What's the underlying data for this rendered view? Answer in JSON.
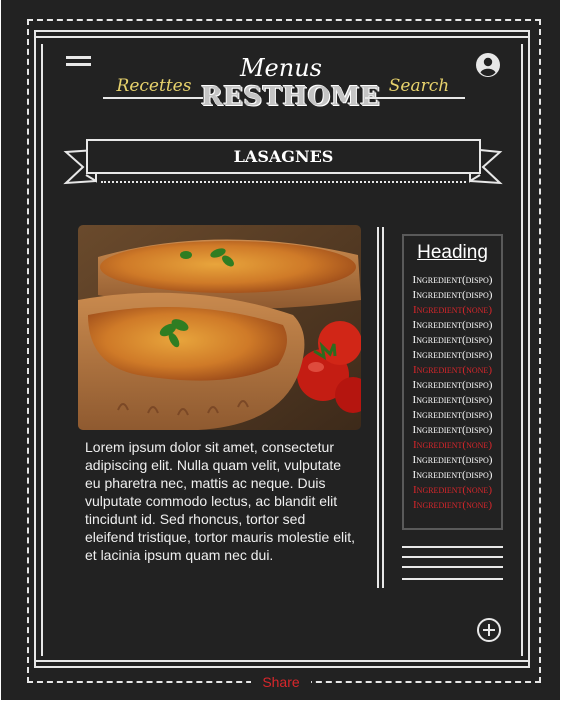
{
  "header": {
    "menus_label": "Menus",
    "brand": "RESTHOME",
    "nav_left": "Recettes",
    "nav_right": "Search"
  },
  "icons": {
    "menu": "hamburger-icon",
    "account": "account-circle-icon",
    "add": "add-circle-icon"
  },
  "banner": {
    "title": "LASAGNES"
  },
  "recipe": {
    "image_alt": "Two dishes of baked lasagne with basil and tomatoes",
    "description": "Lorem ipsum dolor sit amet, consectetur adipiscing elit. Nulla quam velit, vulputate eu pharetra nec, mattis ac neque. Duis vulputate commodo lectus, ac blandit elit tincidunt id. Sed rhoncus, tortor sed eleifend tristique, tortor mauris molestie elit, et lacinia ipsum quam nec dui."
  },
  "ingredients": {
    "heading": "Heading",
    "items": [
      {
        "label": "Ingredient(dispo)",
        "available": true
      },
      {
        "label": "Ingredient(dispo)",
        "available": true
      },
      {
        "label": "Ingredient(none)",
        "available": false
      },
      {
        "label": "Ingredient(dispo)",
        "available": true
      },
      {
        "label": "Ingredient(dispo)",
        "available": true
      },
      {
        "label": "Ingredient(dispo)",
        "available": true
      },
      {
        "label": "Ingredient(none)",
        "available": false
      },
      {
        "label": "Ingredient(dispo)",
        "available": true
      },
      {
        "label": "Ingredient(dispo)",
        "available": true
      },
      {
        "label": "Ingredient(dispo)",
        "available": true
      },
      {
        "label": "Ingredient(dispo)",
        "available": true
      },
      {
        "label": "Ingredient(none)",
        "available": false
      },
      {
        "label": "Ingredient(dispo)",
        "available": true
      },
      {
        "label": "Ingredient(dispo)",
        "available": true
      },
      {
        "label": "Ingredient(none)",
        "available": false
      },
      {
        "label": "Ingredient(none)",
        "available": false
      }
    ]
  },
  "footer": {
    "share": "Share"
  },
  "colors": {
    "background": "#222222",
    "lines": "#e8e8e8",
    "accent_script": "#e7d26c",
    "unavailable": "#d8262b"
  }
}
